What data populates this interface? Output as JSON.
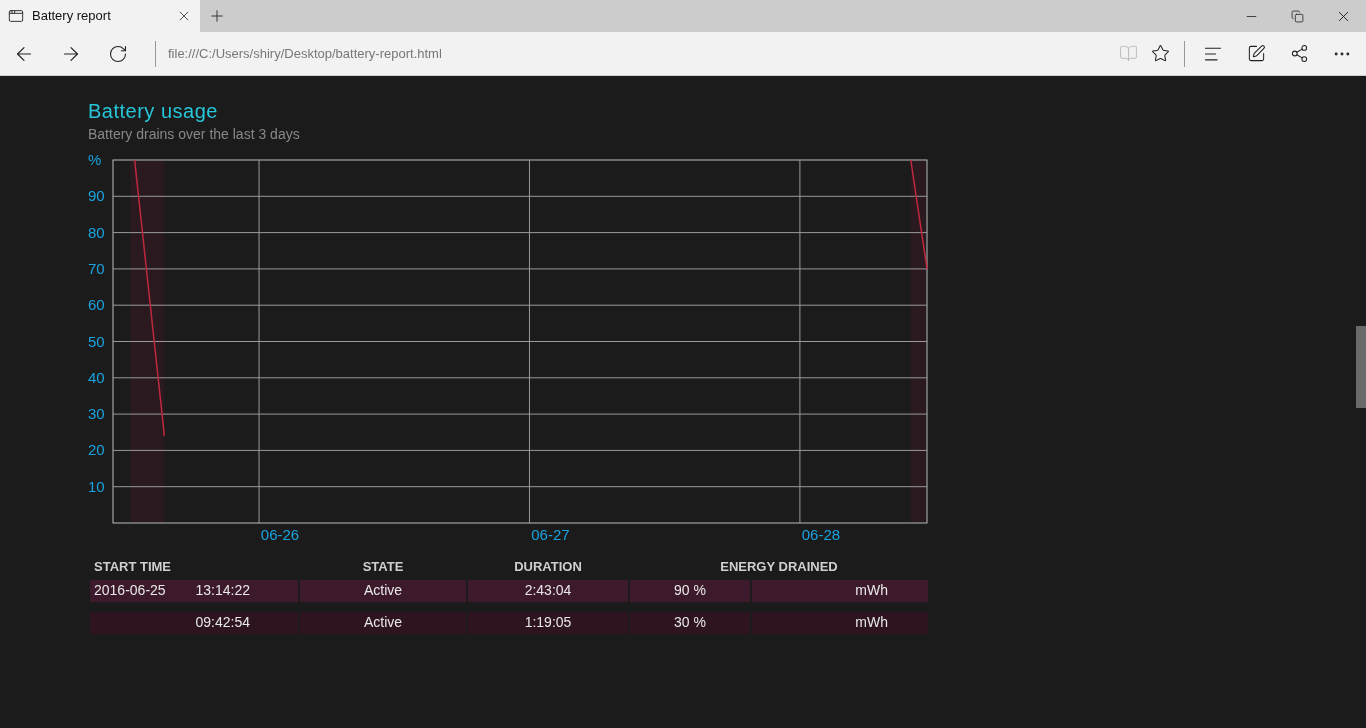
{
  "tab": {
    "title": "Battery report",
    "selected": true
  },
  "address": {
    "value": "file:///C:/Users/shiry/Desktop/battery-report.html"
  },
  "toolbar": {
    "reading_view_disabled": true
  },
  "section": {
    "title": "Battery usage",
    "subtitle": "Battery drains over the last 3 days"
  },
  "chart": {
    "y_labels": [
      "%",
      "90",
      "80",
      "70",
      "60",
      "50",
      "40",
      "30",
      "20",
      "10"
    ],
    "x_labels": [
      "06-26",
      "06-27",
      "06-28"
    ]
  },
  "table": {
    "columns": [
      {
        "label": "START TIME"
      },
      {
        "label": "STATE"
      },
      {
        "label": "DURATION"
      },
      {
        "label": "ENERGY DRAINED"
      }
    ],
    "rows": [
      {
        "selected": true,
        "date": "2016-06-25",
        "time": "13:14:22",
        "state": "Active",
        "duration": "2:43:04",
        "percent": "90 %",
        "energy": "mWh"
      },
      {
        "selected": false,
        "time": "09:42:54",
        "state": "Active",
        "duration": "1:19:05",
        "percent": "30 %",
        "energy": "mWh"
      }
    ]
  }
}
